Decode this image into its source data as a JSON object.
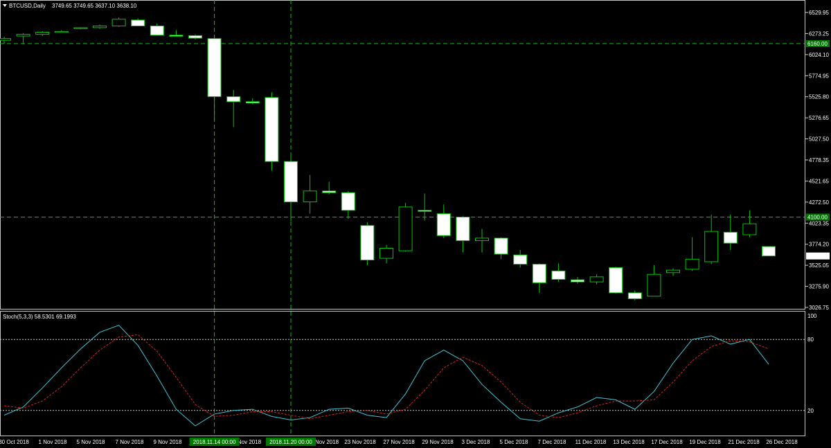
{
  "chart_data": [
    {
      "type": "candlestick",
      "title": "BTCUSD,Daily",
      "ohlc_readout": "3749.65 3749.65 3637.10 3638.10",
      "ylim": [
        3026.75,
        6529.95
      ],
      "y_ticks": [
        "6529.95",
        "6273.25",
        "6024.10",
        "5774.95",
        "5525.80",
        "5276.65",
        "5027.50",
        "4778.35",
        "4521.65",
        "4272.50",
        "4023.35",
        "3774.20",
        "3525.05",
        "3275.90",
        "3026.75"
      ],
      "x_ticks": [
        "30 Oct 2018",
        "1 Nov 2018",
        "5 Nov 2018",
        "7 Nov 2018",
        "9 Nov 2018",
        "",
        "Nov 2018",
        "",
        "Nov 2018",
        "23 Nov 2018",
        "27 Nov 2018",
        "29 Nov 2018",
        "3 Dec 2018",
        "5 Dec 2018",
        "7 Dec 2018",
        "11 Dec 2018",
        "13 Dec 2018",
        "17 Dec 2018",
        "19 Dec 2018",
        "21 Dec 2018",
        "26 Dec 2018"
      ],
      "candles": [
        {
          "o": 6200,
          "h": 6240,
          "l": 6160,
          "c": 6220
        },
        {
          "o": 6250,
          "h": 6285,
          "l": 6150,
          "c": 6270
        },
        {
          "o": 6270,
          "h": 6310,
          "l": 6250,
          "c": 6295
        },
        {
          "o": 6300,
          "h": 6320,
          "l": 6290,
          "c": 6305
        },
        {
          "o": 6345,
          "h": 6355,
          "l": 6330,
          "c": 6350
        },
        {
          "o": 6350,
          "h": 6385,
          "l": 6335,
          "c": 6370
        },
        {
          "o": 6370,
          "h": 6470,
          "l": 6360,
          "c": 6450
        },
        {
          "o": 6440,
          "h": 6460,
          "l": 6370,
          "c": 6370
        },
        {
          "o": 6370,
          "h": 6400,
          "l": 6260,
          "c": 6260
        },
        {
          "o": 6260,
          "h": 6320,
          "l": 6250,
          "c": 6255
        },
        {
          "o": 6255,
          "h": 6270,
          "l": 6210,
          "c": 6225
        },
        {
          "o": 6220,
          "h": 6250,
          "l": 5250,
          "c": 5530
        },
        {
          "o": 5530,
          "h": 5610,
          "l": 5170,
          "c": 5470
        },
        {
          "o": 5470,
          "h": 5510,
          "l": 5440,
          "c": 5455
        },
        {
          "o": 5520,
          "h": 5580,
          "l": 4650,
          "c": 4760
        },
        {
          "o": 4760,
          "h": 4860,
          "l": 4050,
          "c": 4280
        },
        {
          "o": 4280,
          "h": 4600,
          "l": 4140,
          "c": 4410
        },
        {
          "o": 4410,
          "h": 4520,
          "l": 4370,
          "c": 4390
        },
        {
          "o": 4390,
          "h": 4410,
          "l": 4080,
          "c": 4180
        },
        {
          "o": 4000,
          "h": 4040,
          "l": 3530,
          "c": 3590
        },
        {
          "o": 3610,
          "h": 3770,
          "l": 3550,
          "c": 3730
        },
        {
          "o": 3700,
          "h": 4270,
          "l": 3690,
          "c": 4220
        },
        {
          "o": 4180,
          "h": 4380,
          "l": 4060,
          "c": 4170
        },
        {
          "o": 4140,
          "h": 4250,
          "l": 3850,
          "c": 3880
        },
        {
          "o": 4100,
          "h": 4110,
          "l": 3680,
          "c": 3820
        },
        {
          "o": 3820,
          "h": 3960,
          "l": 3680,
          "c": 3850
        },
        {
          "o": 3850,
          "h": 3860,
          "l": 3600,
          "c": 3660
        },
        {
          "o": 3650,
          "h": 3710,
          "l": 3500,
          "c": 3540
        },
        {
          "o": 3540,
          "h": 3550,
          "l": 3200,
          "c": 3320
        },
        {
          "o": 3460,
          "h": 3550,
          "l": 3330,
          "c": 3360
        },
        {
          "o": 3355,
          "h": 3390,
          "l": 3310,
          "c": 3330
        },
        {
          "o": 3330,
          "h": 3420,
          "l": 3300,
          "c": 3390
        },
        {
          "o": 3500,
          "h": 3510,
          "l": 3190,
          "c": 3200
        },
        {
          "o": 3200,
          "h": 3230,
          "l": 3110,
          "c": 3130
        },
        {
          "o": 3160,
          "h": 3530,
          "l": 3160,
          "c": 3420
        },
        {
          "o": 3440,
          "h": 3490,
          "l": 3400,
          "c": 3470
        },
        {
          "o": 3480,
          "h": 3860,
          "l": 3460,
          "c": 3600
        },
        {
          "o": 3570,
          "h": 4130,
          "l": 3540,
          "c": 3930
        },
        {
          "o": 3920,
          "h": 4130,
          "l": 3710,
          "c": 3790
        },
        {
          "o": 3890,
          "h": 4180,
          "l": 3860,
          "c": 4020
        },
        {
          "o": 3750,
          "h": 3750,
          "l": 3637,
          "c": 3638
        }
      ],
      "h_lines": [
        {
          "value": 6160,
          "label": "6160.00"
        },
        {
          "value": 4100,
          "label": "4100.00"
        }
      ],
      "current_price": "3638.10",
      "v_marks": [
        {
          "index": 11,
          "label": "2018.11.14 00:00"
        },
        {
          "index": 15,
          "label": "2018.11.20 00:00"
        }
      ],
      "colors": {
        "bg": "#000000",
        "up": "#000000",
        "down": "#ffffff",
        "wick": "#00c800",
        "grid": "#00c800"
      }
    },
    {
      "type": "line",
      "title": "Stoch(5,3,3) 58.5301 69.1993",
      "ylim": [
        0,
        100
      ],
      "y_ticks": [
        "100",
        "80",
        "20",
        "0"
      ],
      "levels": [
        80,
        20
      ],
      "series": [
        {
          "key": "main",
          "color": "#40c8d8",
          "values": [
            16,
            23,
            39,
            56,
            72,
            86,
            92,
            75,
            49,
            21,
            7,
            17,
            20,
            21,
            15,
            12,
            14,
            21,
            22,
            16,
            14,
            34,
            62,
            71,
            62,
            42,
            27,
            13,
            11,
            18,
            23,
            31,
            29,
            21,
            36,
            60,
            80,
            83,
            76,
            80,
            59
          ]
        },
        {
          "key": "signal",
          "color": "#e02020",
          "values": [
            24,
            22,
            28,
            40,
            56,
            71,
            82,
            84,
            70,
            48,
            25,
            15,
            16,
            19,
            19,
            16,
            13,
            16,
            19,
            20,
            17,
            21,
            37,
            56,
            65,
            58,
            44,
            27,
            16,
            14,
            18,
            24,
            28,
            28,
            29,
            44,
            62,
            74,
            79,
            78,
            72
          ]
        }
      ]
    }
  ]
}
